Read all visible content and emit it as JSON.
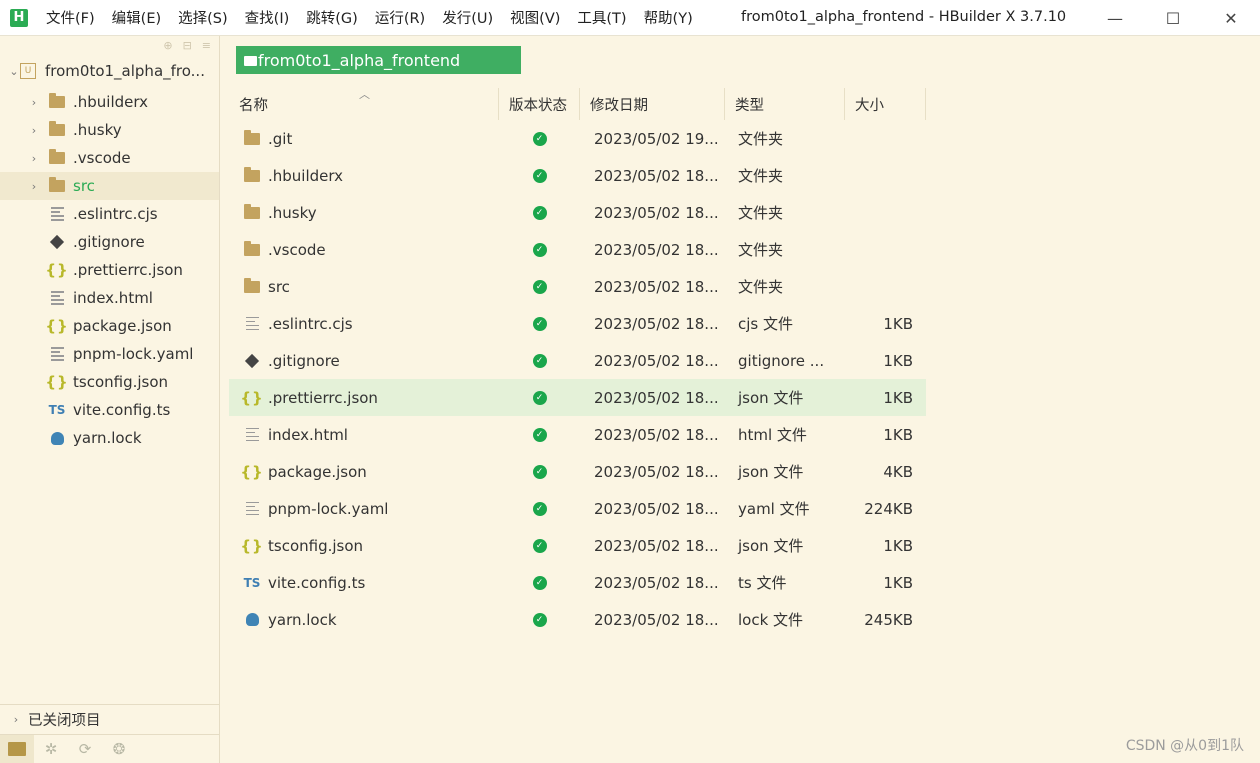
{
  "app": {
    "logo_letter": "H",
    "window_title": "from0to1_alpha_frontend - HBuilder X 3.7.10"
  },
  "menu": [
    "文件(F)",
    "编辑(E)",
    "选择(S)",
    "查找(I)",
    "跳转(G)",
    "运行(R)",
    "发行(U)",
    "视图(V)",
    "工具(T)",
    "帮助(Y)"
  ],
  "window_controls": {
    "minimize": "—",
    "maximize": "☐",
    "close": "✕"
  },
  "sidebar": {
    "project": "from0to1_alpha_fro...",
    "items": [
      {
        "label": ".hbuilderx",
        "icon": "folder",
        "expandable": true
      },
      {
        "label": ".husky",
        "icon": "folder",
        "expandable": true
      },
      {
        "label": ".vscode",
        "icon": "folder",
        "expandable": true
      },
      {
        "label": "src",
        "icon": "folder",
        "expandable": true,
        "selected": true
      },
      {
        "label": ".eslintrc.cjs",
        "icon": "lines"
      },
      {
        "label": ".gitignore",
        "icon": "git"
      },
      {
        "label": ".prettierrc.json",
        "icon": "braces"
      },
      {
        "label": "index.html",
        "icon": "lines"
      },
      {
        "label": "package.json",
        "icon": "braces"
      },
      {
        "label": "pnpm-lock.yaml",
        "icon": "lines"
      },
      {
        "label": "tsconfig.json",
        "icon": "braces"
      },
      {
        "label": "vite.config.ts",
        "icon": "ts"
      },
      {
        "label": "yarn.lock",
        "icon": "yarn"
      }
    ],
    "closed_projects": "已关闭项目"
  },
  "path_tab": "from0to1_alpha_frontend",
  "columns": {
    "name": "名称",
    "status": "版本状态",
    "date": "修改日期",
    "type": "类型",
    "size": "大小"
  },
  "files": [
    {
      "name": ".git",
      "icon": "folder",
      "date": "2023/05/02 19...",
      "type": "文件夹",
      "size": ""
    },
    {
      "name": ".hbuilderx",
      "icon": "folder",
      "date": "2023/05/02 18...",
      "type": "文件夹",
      "size": ""
    },
    {
      "name": ".husky",
      "icon": "folder",
      "date": "2023/05/02 18...",
      "type": "文件夹",
      "size": ""
    },
    {
      "name": ".vscode",
      "icon": "folder",
      "date": "2023/05/02 18...",
      "type": "文件夹",
      "size": ""
    },
    {
      "name": "src",
      "icon": "folder",
      "date": "2023/05/02 18...",
      "type": "文件夹",
      "size": ""
    },
    {
      "name": ".eslintrc.cjs",
      "icon": "lines",
      "date": "2023/05/02 18...",
      "type": "cjs 文件",
      "size": "1KB"
    },
    {
      "name": ".gitignore",
      "icon": "git",
      "date": "2023/05/02 18...",
      "type": "gitignore ...",
      "size": "1KB"
    },
    {
      "name": ".prettierrc.json",
      "icon": "braces",
      "date": "2023/05/02 18...",
      "type": "json 文件",
      "size": "1KB",
      "selected": true
    },
    {
      "name": "index.html",
      "icon": "lines",
      "date": "2023/05/02 18...",
      "type": "html 文件",
      "size": "1KB"
    },
    {
      "name": "package.json",
      "icon": "braces",
      "date": "2023/05/02 18...",
      "type": "json 文件",
      "size": "4KB"
    },
    {
      "name": "pnpm-lock.yaml",
      "icon": "lines",
      "date": "2023/05/02 18...",
      "type": "yaml 文件",
      "size": "224KB"
    },
    {
      "name": "tsconfig.json",
      "icon": "braces",
      "date": "2023/05/02 18...",
      "type": "json 文件",
      "size": "1KB"
    },
    {
      "name": "vite.config.ts",
      "icon": "ts",
      "date": "2023/05/02 18...",
      "type": "ts 文件",
      "size": "1KB"
    },
    {
      "name": "yarn.lock",
      "icon": "yarn",
      "date": "2023/05/02 18...",
      "type": "lock 文件",
      "size": "245KB"
    }
  ],
  "watermark": "CSDN @从0到1队",
  "colors": {
    "accent": "#3fae62",
    "background": "#fbf5e3",
    "selected_row": "#e4f1d8",
    "status_ok": "#1aa64b"
  }
}
